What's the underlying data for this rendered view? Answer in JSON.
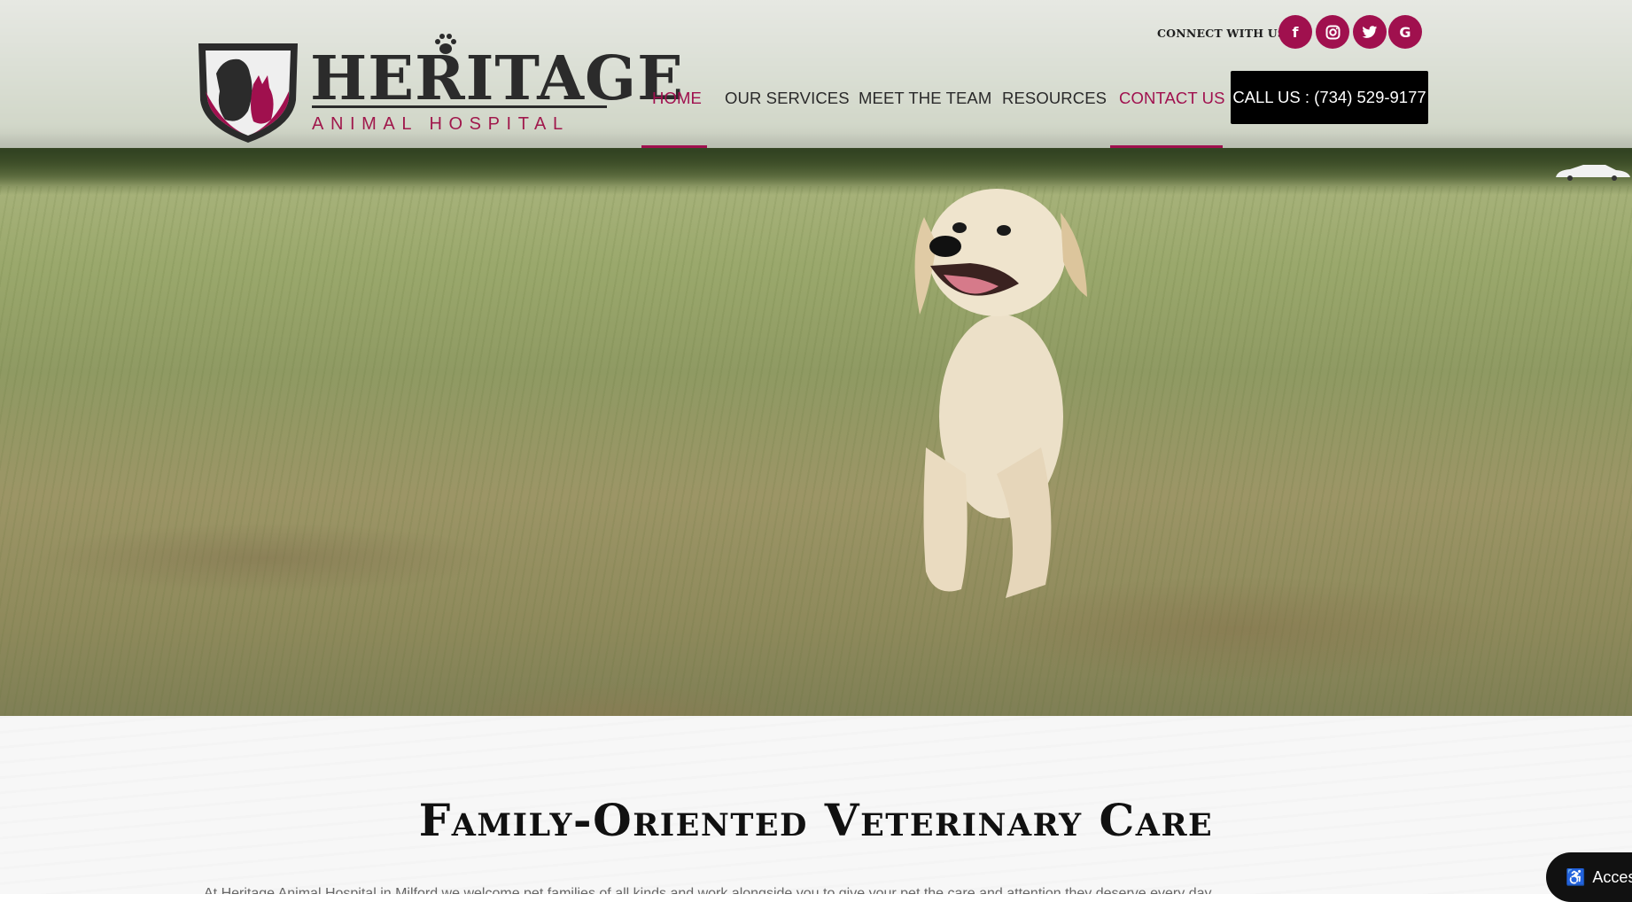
{
  "brand": {
    "name": "HERITAGE",
    "tagline": "ANIMAL HOSPITAL"
  },
  "header": {
    "connect_label": "CONNECT WITH US:",
    "social": [
      {
        "name": "facebook-icon",
        "glyph": "f"
      },
      {
        "name": "instagram-icon",
        "glyph": "◎"
      },
      {
        "name": "twitter-icon",
        "glyph": "🐦"
      },
      {
        "name": "google-icon",
        "glyph": "G"
      }
    ],
    "call_button": "CALL US : (734) 529-9177"
  },
  "nav": {
    "items": [
      {
        "label": "HOME",
        "active": true
      },
      {
        "label": "OUR SERVICES",
        "active": false
      },
      {
        "label": "MEET THE TEAM",
        "active": false
      },
      {
        "label": "RESOURCES",
        "active": false
      },
      {
        "label": "CONTACT US",
        "active": true
      }
    ]
  },
  "main": {
    "heading": "Family-Oriented Veterinary Care",
    "body_peek": "At Heritage Animal Hospital in Milford we welcome pet families of all kinds and work alongside you to give your pet the care and attention they deserve every day"
  },
  "accessibility": {
    "label": "Access"
  },
  "colors": {
    "accent": "#a0104e",
    "call_button_bg": "#000000",
    "header_overlay": "rgba(236,236,232,0.72)"
  }
}
